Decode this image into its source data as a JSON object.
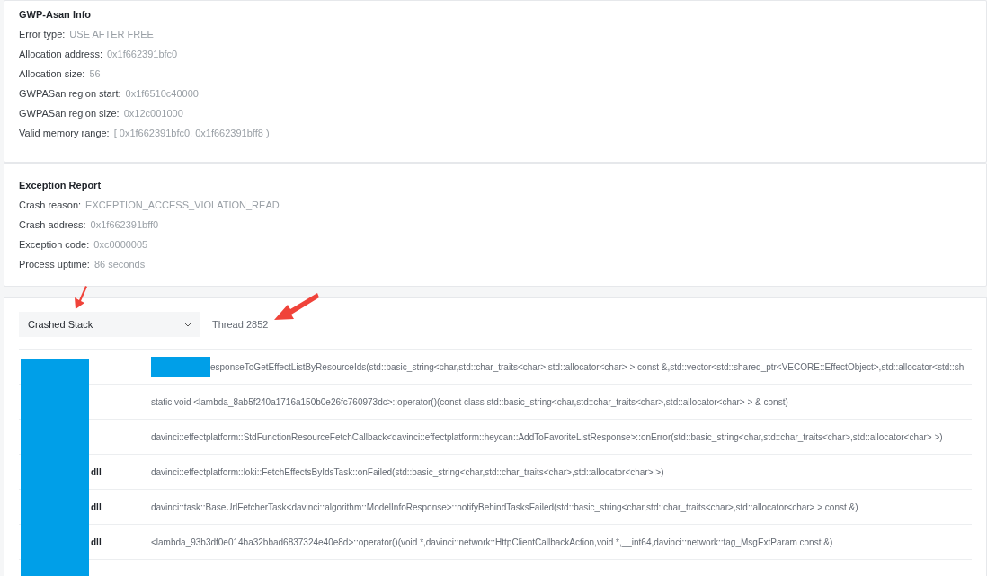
{
  "gwp_asan_info": {
    "title": "GWP-Asan Info",
    "fields": [
      {
        "label": "Error type:",
        "value": "USE AFTER FREE"
      },
      {
        "label": "Allocation address:",
        "value": "0x1f662391bfc0"
      },
      {
        "label": "Allocation size:",
        "value": "56"
      },
      {
        "label": "GWPASan region start:",
        "value": "0x1f6510c40000"
      },
      {
        "label": "GWPASan region size:",
        "value": "0x12c001000"
      },
      {
        "label": "Valid memory range:",
        "value": "[ 0x1f662391bfc0, 0x1f662391bff8 )"
      }
    ]
  },
  "exception_report": {
    "title": "Exception Report",
    "fields": [
      {
        "label": "Crash reason:",
        "value": "EXCEPTION_ACCESS_VIOLATION_READ"
      },
      {
        "label": "Crash address:",
        "value": "0x1f662391bff0"
      },
      {
        "label": "Exception code:",
        "value": "0xc0000005"
      },
      {
        "label": "Process uptime:",
        "value": "86 seconds"
      }
    ]
  },
  "stack": {
    "dropdown": "Crashed Stack",
    "thread": "Thread 2852",
    "rows": [
      {
        "function": "esponseToGetEffectListByResourceIds(std::basic_string<char,std::char_traits<char>,std::allocator<char> > const &,std::vector<std::shared_ptr<VECORE::EffectObject>,std::allocator<std::sh",
        "redacted_prefix": true
      },
      {
        "function": "static void <lambda_8ab5f240a1716a150b0e26fc760973dc>::operator()(const class std::basic_string<char,std::char_traits<char>,std::allocator<char> > & const)"
      },
      {
        "function": "davinci::effectplatform::StdFunctionResourceFetchCallback<davinci::effectplatform::heycan::AddToFavoriteListResponse>::onError(std::basic_string<char,std::char_traits<char>,std::allocator<char> >)"
      },
      {
        "module": "dll",
        "function": "davinci::effectplatform::loki::FetchEffectsByIdsTask::onFailed(std::basic_string<char,std::char_traits<char>,std::allocator<char> >)"
      },
      {
        "module": "dll",
        "function": "davinci::task::BaseUrlFetcherTask<davinci::algorithm::ModelInfoResponse>::notifyBehindTasksFailed(std::basic_string<char,std::char_traits<char>,std::allocator<char> > const &)"
      },
      {
        "module": "dll",
        "function": "<lambda_93b3df0e014ba32bbad6837324e40e8d>::operator()(void *,davinci::network::HttpClientCallbackAction,void *,__int64,davinci::network::tag_MsgExtParam const &)"
      }
    ]
  }
}
